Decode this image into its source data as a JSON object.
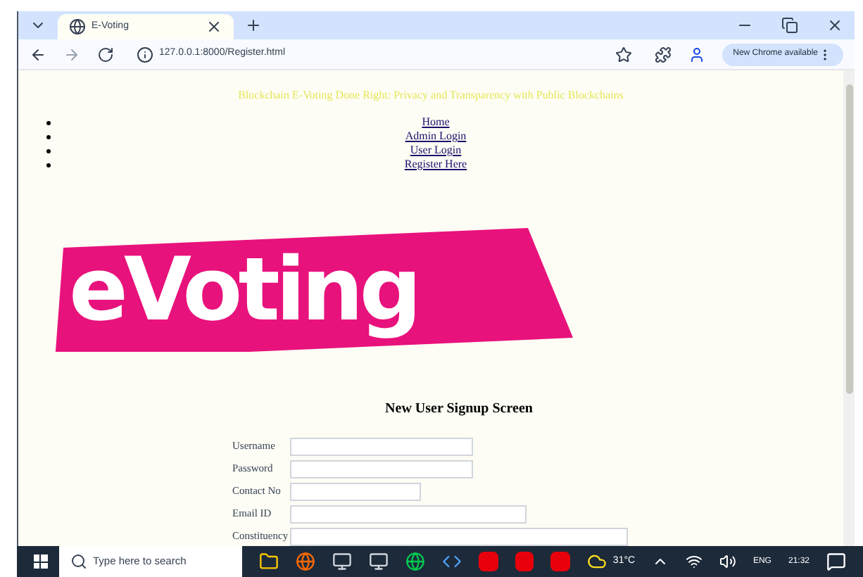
{
  "browser": {
    "tab": {
      "title": "E-Voting",
      "selected": true
    },
    "address": "127.0.0.1:8000/Register.html",
    "update_button": "New Chrome available"
  },
  "page": {
    "heading": "Blockchain E-Voting Done Right: Privacy and Transparency with Public Blockchains",
    "nav": [
      {
        "label": "Home"
      },
      {
        "label": "Admin Login"
      },
      {
        "label": "User Login"
      },
      {
        "label": "Register Here"
      }
    ],
    "logo": "eVoting",
    "form": {
      "title": "New User Signup Screen",
      "fields": [
        {
          "label": "Username"
        },
        {
          "label": "Password"
        },
        {
          "label": "Contact No"
        },
        {
          "label": "Email ID"
        },
        {
          "label": "Constituency"
        }
      ]
    }
  },
  "taskbar": {
    "search_placeholder": "Type here to search",
    "weather": "31°C",
    "language": "ENG",
    "time": "21:32"
  }
}
